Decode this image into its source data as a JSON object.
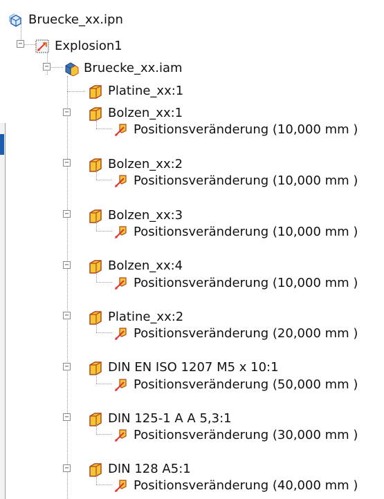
{
  "tree": {
    "root": {
      "label": "Bruecke_xx.ipn",
      "icon": "presentation-file-icon"
    },
    "explosion": {
      "label": "Explosion1",
      "icon": "explosion-view-icon",
      "toggle": "−"
    },
    "assembly": {
      "label": "Bruecke_xx.iam",
      "icon": "assembly-icon",
      "toggle": "−"
    },
    "parts": [
      {
        "label": "Platine_xx:1",
        "icon": "part-icon"
      },
      {
        "label": "Bolzen_xx:1",
        "icon": "part-icon",
        "toggle": "−"
      },
      {
        "label": "Positionsveränderung (10,000 mm )",
        "icon": "position-change-icon"
      },
      {
        "label": "Bolzen_xx:2",
        "icon": "part-icon",
        "toggle": "−"
      },
      {
        "label": "Positionsveränderung (10,000 mm )",
        "icon": "position-change-icon"
      },
      {
        "label": "Bolzen_xx:3",
        "icon": "part-icon",
        "toggle": "−"
      },
      {
        "label": "Positionsveränderung (10,000 mm )",
        "icon": "position-change-icon"
      },
      {
        "label": "Bolzen_xx:4",
        "icon": "part-icon",
        "toggle": "−"
      },
      {
        "label": "Positionsveränderung (10,000 mm )",
        "icon": "position-change-icon"
      },
      {
        "label": "Platine_xx:2",
        "icon": "part-icon",
        "toggle": "−"
      },
      {
        "label": "Positionsveränderung (20,000 mm )",
        "icon": "position-change-icon"
      },
      {
        "label": "DIN EN ISO 1207 M5 x 10:1",
        "icon": "part-icon",
        "toggle": "−"
      },
      {
        "label": "Positionsveränderung (50,000 mm )",
        "icon": "position-change-icon"
      },
      {
        "label": "DIN 125-1 A A 5,3:1",
        "icon": "part-icon",
        "toggle": "−"
      },
      {
        "label": "Positionsveränderung (30,000 mm )",
        "icon": "position-change-icon"
      },
      {
        "label": "DIN 128 A5:1",
        "icon": "part-icon",
        "toggle": "−"
      },
      {
        "label": "Positionsveränderung (40,000 mm )",
        "icon": "position-change-icon"
      }
    ]
  },
  "colors": {
    "part_fill": "#f5c533",
    "part_edge": "#c8471c",
    "assembly_blue": "#3f73b8",
    "explosion_arrow": "#e0322e"
  }
}
